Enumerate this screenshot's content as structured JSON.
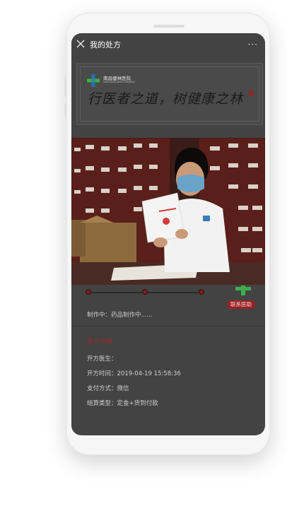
{
  "header": {
    "title": "我的处方",
    "more": "···"
  },
  "banner": {
    "hospital_name": "南昌健林医院",
    "hospital_name_en": "Nanchang Jianlin Hospital",
    "slogan": "行医者之道，树健康之林",
    "colors": {
      "cross_blue": "#2a6fb0",
      "cross_green": "#3fae49",
      "seal_red": "#8a2a2a"
    }
  },
  "progress": {
    "steps_total": 3,
    "contact_label": "联系医助",
    "status_text": "制作中：药品制作中......"
  },
  "details": {
    "section_title": "处方详情",
    "doctor_label": "开方医生：",
    "time_label": "开方时间：",
    "time_value": "2019-04-19  15:58:36",
    "payment_label": "支付方式：",
    "payment_value": "微信",
    "settlement_label": "结算类型：",
    "settlement_value": "定金+货到付款"
  },
  "colors": {
    "accent_red": "#9b2222",
    "overlay": "#434343"
  }
}
